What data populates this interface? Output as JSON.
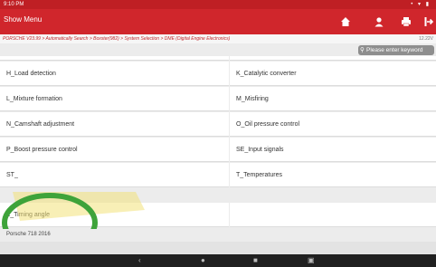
{
  "status": {
    "time": "9:10 PM",
    "right_icons": "• ▾ ▮"
  },
  "header": {
    "title": "Show Menu",
    "accent": "#d0262c"
  },
  "breadcrumb": {
    "path": "PORSCHE V23.99 > Automatically Search > Boxster(982) > System Selection > DME (Digital Engine Electronics)",
    "version": "12.22V"
  },
  "search": {
    "placeholder": "Please enter keyword"
  },
  "menu": {
    "left": [
      "H_Load detection",
      "L_Mixture formation",
      "N_Camshaft adjustment",
      "P_Boost pressure control",
      "ST_",
      "Z_Timing angle"
    ],
    "right": [
      "K_Catalytic converter",
      "M_Misfiring",
      "O_Oil pressure control",
      "SE_Input signals",
      "T_Temperatures",
      ""
    ]
  },
  "vehicle": {
    "label": "Porsche 718 2016"
  }
}
